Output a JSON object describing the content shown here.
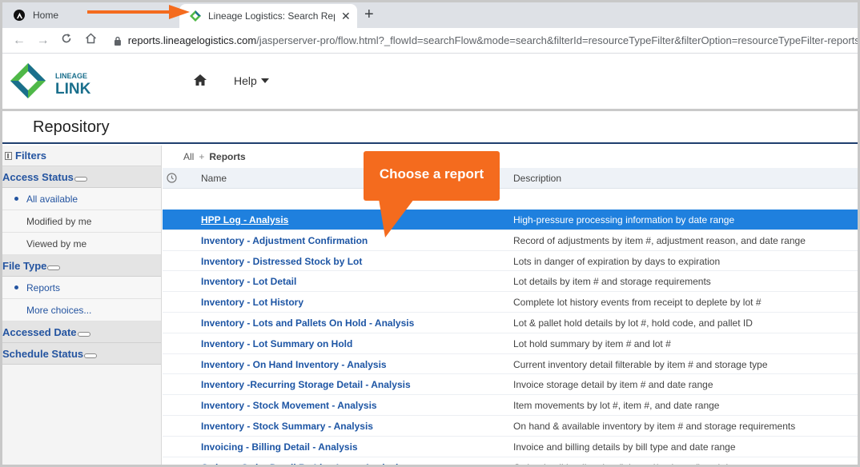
{
  "browser": {
    "tabs": [
      {
        "title": "Home"
      },
      {
        "title": "Lineage Logistics: Search Reposit"
      }
    ],
    "url_host": "reports.lineagelogistics.com",
    "url_path": "/jasperserver-pro/flow.html?_flowId=searchFlow&mode=search&filterId=resourceTypeFilter&filterOption=resourceTypeFilter-reports&s"
  },
  "header": {
    "logo_top": "LINEAGE",
    "logo_bottom": "LINK",
    "help_label": "Help"
  },
  "page": {
    "title": "Repository"
  },
  "sidebar": {
    "filters_label": "Filters",
    "groups": [
      {
        "label": "Access Status",
        "items": [
          {
            "label": "All available",
            "selected": true
          },
          {
            "label": "Modified by me",
            "selected": false
          },
          {
            "label": "Viewed by me",
            "selected": false
          }
        ]
      },
      {
        "label": "File Type",
        "items": [
          {
            "label": "Reports",
            "selected": true
          },
          {
            "label": "More choices...",
            "selected": false
          }
        ]
      },
      {
        "label": "Accessed Date",
        "items": []
      },
      {
        "label": "Schedule Status",
        "items": []
      }
    ]
  },
  "main": {
    "breadcrumb_root": "All",
    "breadcrumb_sep": "+",
    "breadcrumb_current": "Reports",
    "col_name": "Name",
    "col_desc": "Description",
    "rows": [
      {
        "name": "HPP Log - Analysis",
        "desc": "High-pressure processing information by date range"
      },
      {
        "name": "Inventory - Adjustment Confirmation",
        "desc": "Record of adjustments by item #, adjustment reason, and date range"
      },
      {
        "name": "Inventory - Distressed Stock by Lot",
        "desc": "Lots in danger of expiration by days to expiration"
      },
      {
        "name": "Inventory - Lot Detail",
        "desc": "Lot details by item # and storage requirements"
      },
      {
        "name": "Inventory - Lot History",
        "desc": "Complete lot history events from receipt to deplete by lot #"
      },
      {
        "name": "Inventory - Lots and Pallets On Hold - Analysis",
        "desc": "Lot & pallet hold details by lot #, hold code, and pallet ID"
      },
      {
        "name": "Inventory - Lot Summary on Hold",
        "desc": "Lot hold summary by item # and lot #"
      },
      {
        "name": "Inventory - On Hand Inventory - Analysis",
        "desc": "Current inventory detail filterable by item # and storage type"
      },
      {
        "name": "Inventory -Recurring Storage Detail - Analysis",
        "desc": "Invoice storage detail by item # and date range"
      },
      {
        "name": "Inventory - Stock Movement - Analysis",
        "desc": "Item movements by lot #, item #, and date range"
      },
      {
        "name": "Inventory - Stock Summary - Analysis",
        "desc": "On hand & available inventory by item # and storage requirements"
      },
      {
        "name": "Invoicing - Billing Detail - Analysis",
        "desc": "Invoice and billing details by bill type and date range"
      },
      {
        "name": "Orders - Order Detail By Line Item - Analysis",
        "desc": "Order detail by direction (inbound/outbound) and date range"
      }
    ]
  },
  "annotation": {
    "callout_text": "Choose a report",
    "color": "#f46b1e"
  },
  "colors": {
    "selected_row": "#1f80de",
    "link": "#1d55a4",
    "brand_green": "#4fb848",
    "brand_teal": "#1a6f8c"
  }
}
